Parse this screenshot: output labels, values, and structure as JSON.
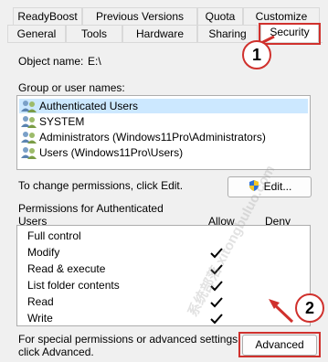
{
  "tabs": {
    "back": [
      "ReadyBoost",
      "Previous Versions",
      "Quota",
      "Customize"
    ],
    "front": [
      "General",
      "Tools",
      "Hardware",
      "Sharing",
      "Security"
    ]
  },
  "object": {
    "label": "Object name:",
    "value": "E:\\"
  },
  "groups": {
    "label": "Group or user names:",
    "items": [
      "Authenticated Users",
      "SYSTEM",
      "Administrators (Windows11Pro\\Administrators)",
      "Users (Windows11Pro\\Users)"
    ],
    "selected_index": 0
  },
  "edit": {
    "hint": "To change permissions, click Edit.",
    "button": "Edit..."
  },
  "permissions": {
    "label_line1": "Permissions for Authenticated",
    "label_line2": "Users",
    "allow": "Allow",
    "deny": "Deny",
    "rows": [
      "Full control",
      "Modify",
      "Read & execute",
      "List folder contents",
      "Read",
      "Write"
    ],
    "allow_checked": [
      false,
      true,
      true,
      true,
      true,
      true
    ]
  },
  "advanced": {
    "hint_line1": "For special permissions or advanced settings,",
    "hint_line2": "click Advanced.",
    "button": "Advanced"
  },
  "callouts": [
    "1",
    "2"
  ],
  "watermark": "系统部落 xitongbuluo.com",
  "colors": {
    "callout": "#d0312d",
    "selection": "#cce8ff",
    "shield_blue": "#2b6fd6",
    "shield_yellow": "#f3c623"
  }
}
